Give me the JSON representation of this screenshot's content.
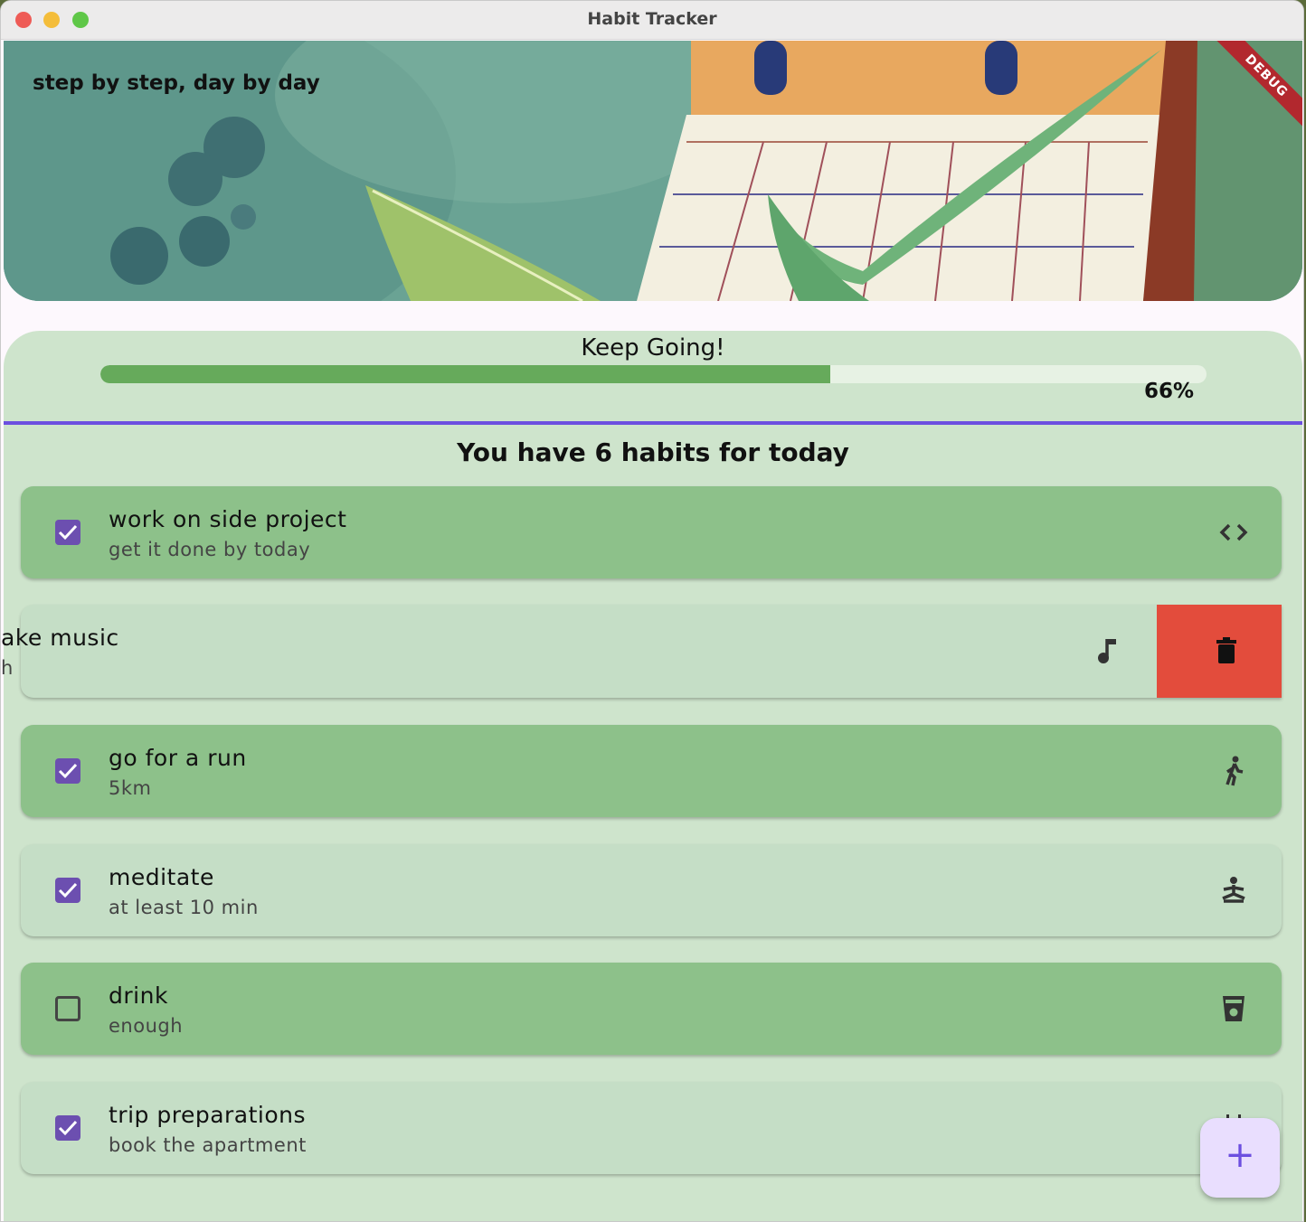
{
  "window": {
    "title": "Habit Tracker"
  },
  "banner": {
    "tagline": "step by step, day by day",
    "debug_label": "DEBUG"
  },
  "progress": {
    "message": "Keep Going!",
    "value": 0.66,
    "label": "66%"
  },
  "summary": "You have 6 habits for today",
  "habits": [
    {
      "title": "work on side project",
      "subtitle": "get it done by today",
      "checked": true,
      "icon": "code-icon"
    },
    {
      "title": "make music",
      "title_visible": "ake music",
      "subtitle_visible": "h",
      "swiped": true,
      "icon": "music-note-icon",
      "action_icon": "trash-icon"
    },
    {
      "title": "go for a run",
      "subtitle": "5km",
      "checked": true,
      "icon": "walking-icon"
    },
    {
      "title": "meditate",
      "subtitle": "at least 10 min",
      "checked": true,
      "icon": "meditation-icon"
    },
    {
      "title": "drink",
      "subtitle": "enough",
      "checked": false,
      "icon": "cup-icon"
    },
    {
      "title": "trip preparations",
      "subtitle": "book the apartment",
      "checked": true,
      "icon": "calendar-icon"
    }
  ],
  "fab": {
    "label": "+"
  },
  "colors": {
    "accent": "#6c4fe0",
    "card_done": "#8dc18a",
    "card_light": "#c5dec6",
    "panel": "#cee4cc",
    "delete": "#e34c3c",
    "progress": "#66aa5b"
  }
}
